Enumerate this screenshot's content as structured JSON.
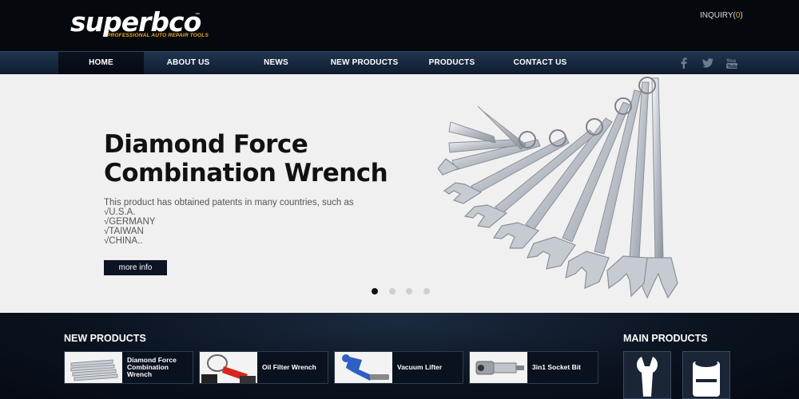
{
  "brand": {
    "name": "superbco",
    "tm": "™",
    "tagline": "PROFESSIONAL AUTO REPAIR TOOLS"
  },
  "header": {
    "inquiry_label": "INQUIRY(",
    "inquiry_count": "0",
    "inquiry_close": ")"
  },
  "nav": {
    "items": [
      {
        "label": "HOME",
        "active": true
      },
      {
        "label": "ABOUT US"
      },
      {
        "label": "NEWS"
      },
      {
        "label": "NEW PRODUCTS"
      },
      {
        "label": "PRODUCTS"
      },
      {
        "label": "CONTACT US"
      }
    ],
    "social": [
      "facebook-icon",
      "twitter-icon",
      "youtube-icon"
    ]
  },
  "hero": {
    "title_line1": "Diamond Force",
    "title_line2": "Combination Wrench",
    "desc_lines": [
      "This product has obtained patents in many countries, such as",
      "√U.S.A.",
      "√GERMANY",
      "√TAIWAN",
      "√CHINA.."
    ],
    "button_label": "more info",
    "slides": 4,
    "active_slide": 1
  },
  "new_products": {
    "title": "NEW PRODUCTS",
    "items": [
      {
        "name": "Diamond Force Combination Wrench"
      },
      {
        "name": "Oil Filter Wrench"
      },
      {
        "name": "Vacuum Lifter"
      },
      {
        "name": "3in1 Socket Bit"
      }
    ]
  },
  "main_products": {
    "title": "MAIN PRODUCTS"
  },
  "colors": {
    "accent": "#f0a91e",
    "nav": "#1b2e46",
    "dark": "#05080d"
  }
}
